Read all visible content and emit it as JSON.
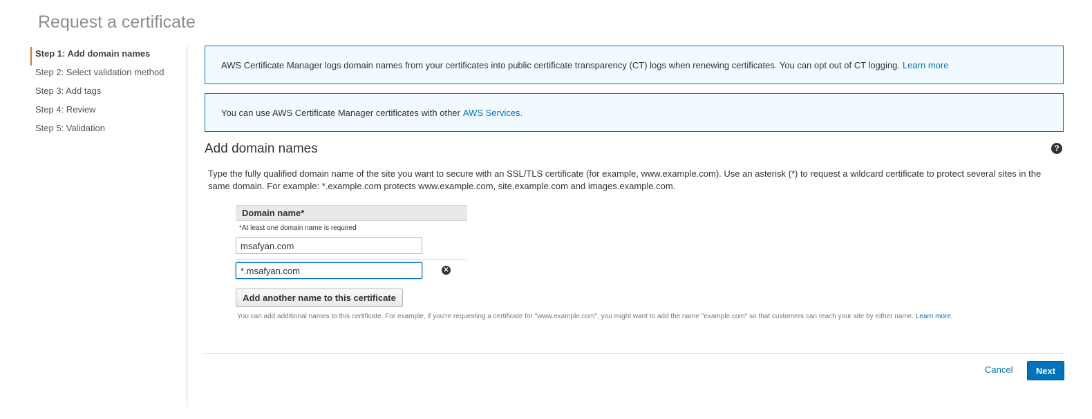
{
  "page": {
    "title": "Request a certificate"
  },
  "steps": [
    {
      "label": "Step 1: Add domain names",
      "active": true
    },
    {
      "label": "Step 2: Select validation method",
      "active": false
    },
    {
      "label": "Step 3: Add tags",
      "active": false
    },
    {
      "label": "Step 4: Review",
      "active": false
    },
    {
      "label": "Step 5: Validation",
      "active": false
    }
  ],
  "info_boxes": [
    {
      "text": "AWS Certificate Manager logs domain names from your certificates into public certificate transparency (CT) logs when renewing certificates. You can opt out of CT logging.",
      "link": "Learn more"
    },
    {
      "text": "You can use AWS Certificate Manager certificates with other",
      "link": "AWS Services."
    }
  ],
  "section": {
    "title": "Add domain names",
    "description": "Type the fully qualified domain name of the site you want to secure with an SSL/TLS certificate (for example, www.example.com). Use an asterisk (*) to request a wildcard certificate to protect several sites in the same domain. For example: *.example.com protects www.example.com, site.example.com and images.example.com."
  },
  "domain_table": {
    "header": "Domain name*",
    "required_note": "*At least one domain name is required",
    "domains": [
      "msafyan.com",
      "*.msafyan.com"
    ]
  },
  "add_button": "Add another name to this certificate",
  "hint": {
    "text": "You can add additional names to this certificate. For example, if you're requesting a certificate for \"www.example.com\", you might want to add the name \"example.com\" so that customers can reach your site by either name.",
    "link": "Learn more."
  },
  "footer": {
    "cancel": "Cancel",
    "next": "Next"
  },
  "colors": {
    "accent": "#0073bb",
    "step_marker": "#ec7211",
    "info_bg": "#f1faff"
  },
  "icons": {
    "help": "question-circle-icon",
    "remove": "remove-circle-icon"
  }
}
